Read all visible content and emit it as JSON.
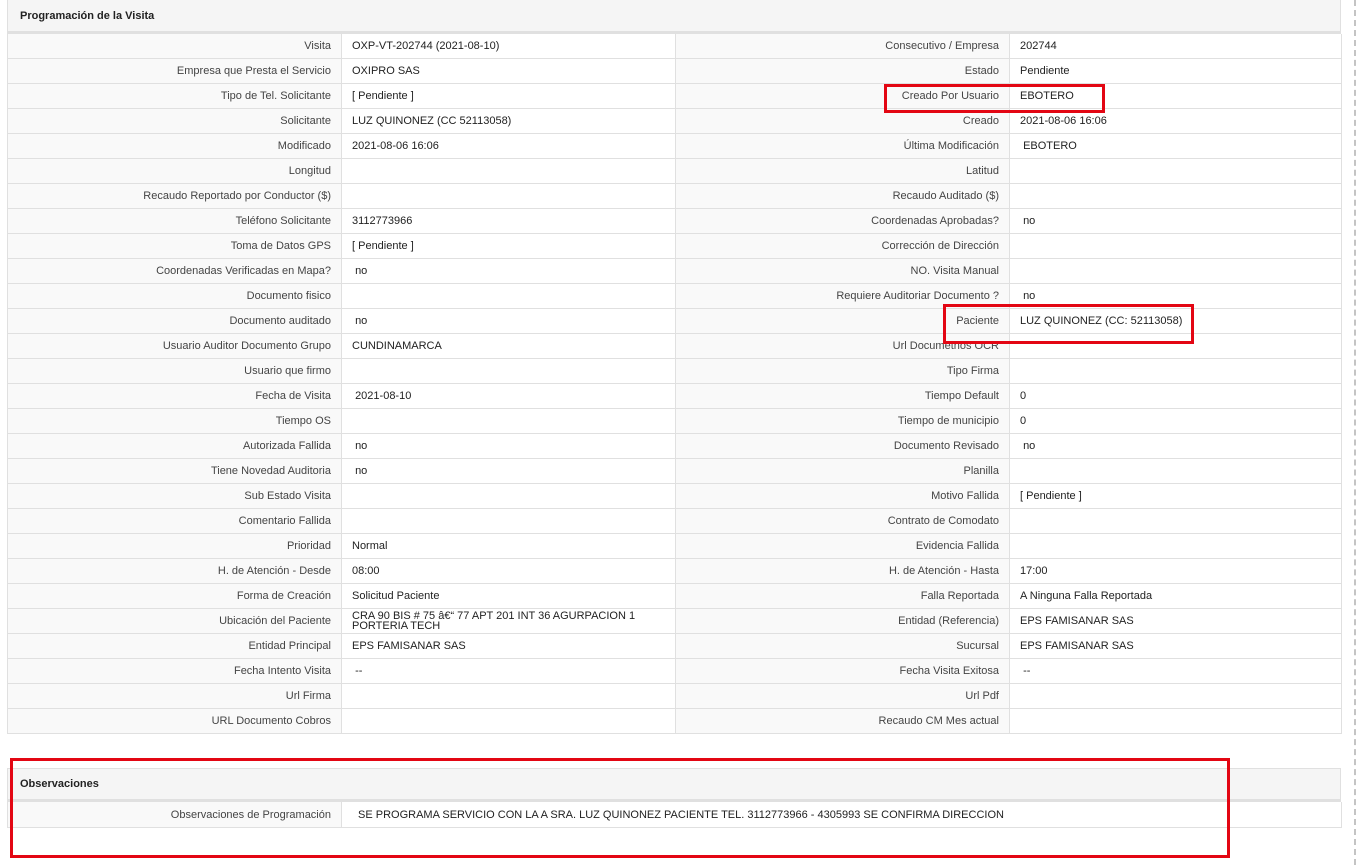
{
  "colors": {
    "highlight": "#e30613",
    "header_bg": "#f5f5f5",
    "border": "#e0e0e0"
  },
  "programacion": {
    "title": "Programación de la Visita",
    "rows": [
      [
        {
          "label": "Visita",
          "value": "OXP-VT-202744 (2021-08-10)"
        },
        {
          "label": "Consecutivo / Empresa",
          "value": "202744"
        }
      ],
      [
        {
          "label": "Empresa que Presta el Servicio",
          "value": "OXIPRO SAS"
        },
        {
          "label": "Estado",
          "value": "Pendiente"
        }
      ],
      [
        {
          "label": "Tipo de Tel. Solicitante",
          "value": "[ Pendiente ]"
        },
        {
          "label": "Creado Por Usuario",
          "value": "EBOTERO"
        }
      ],
      [
        {
          "label": "Solicitante",
          "value": "LUZ QUINONEZ (CC 52113058)"
        },
        {
          "label": "Creado",
          "value": "2021-08-06 16:06"
        }
      ],
      [
        {
          "label": "Modificado",
          "value": "2021-08-06 16:06"
        },
        {
          "label": "Última Modificación",
          "value": " EBOTERO"
        }
      ],
      [
        {
          "label": "Longitud",
          "value": ""
        },
        {
          "label": "Latitud",
          "value": ""
        }
      ],
      [
        {
          "label": "Recaudo Reportado por Conductor ($)",
          "value": ""
        },
        {
          "label": "Recaudo Auditado ($)",
          "value": ""
        }
      ],
      [
        {
          "label": "Teléfono Solicitante",
          "value": "3112773966"
        },
        {
          "label": "Coordenadas Aprobadas?",
          "value": " no"
        }
      ],
      [
        {
          "label": "Toma de Datos GPS",
          "value": "[ Pendiente ]"
        },
        {
          "label": "Corrección de Dirección",
          "value": ""
        }
      ],
      [
        {
          "label": "Coordenadas Verificadas en Mapa?",
          "value": " no"
        },
        {
          "label": "NO. Visita Manual",
          "value": ""
        }
      ],
      [
        {
          "label": "Documento fisico",
          "value": ""
        },
        {
          "label": "Requiere Auditoriar Documento ?",
          "value": " no"
        }
      ],
      [
        {
          "label": "Documento auditado",
          "value": " no"
        },
        {
          "label": "Paciente",
          "value": "LUZ QUINONEZ (CC: 52113058)"
        }
      ],
      [
        {
          "label": "Usuario Auditor Documento Grupo",
          "value": "CUNDINAMARCA"
        },
        {
          "label": "Url Documetnos OCR",
          "value": ""
        }
      ],
      [
        {
          "label": "Usuario que firmo",
          "value": ""
        },
        {
          "label": "Tipo Firma",
          "value": ""
        }
      ],
      [
        {
          "label": "Fecha de Visita",
          "value": " 2021-08-10"
        },
        {
          "label": "Tiempo Default",
          "value": "0"
        }
      ],
      [
        {
          "label": "Tiempo OS",
          "value": ""
        },
        {
          "label": "Tiempo de municipio",
          "value": "0"
        }
      ],
      [
        {
          "label": "Autorizada Fallida",
          "value": " no"
        },
        {
          "label": "Documento Revisado",
          "value": " no"
        }
      ],
      [
        {
          "label": "Tiene Novedad Auditoria",
          "value": " no"
        },
        {
          "label": "Planilla",
          "value": ""
        }
      ],
      [
        {
          "label": "Sub Estado Visita",
          "value": ""
        },
        {
          "label": "Motivo Fallida",
          "value": "[ Pendiente ]"
        }
      ],
      [
        {
          "label": "Comentario Fallida",
          "value": ""
        },
        {
          "label": "Contrato de Comodato",
          "value": ""
        }
      ],
      [
        {
          "label": "Prioridad",
          "value": "Normal"
        },
        {
          "label": "Evidencia Fallida",
          "value": ""
        }
      ],
      [
        {
          "label": "H. de Atención - Desde",
          "value": "08:00"
        },
        {
          "label": "H. de Atención - Hasta",
          "value": "17:00"
        }
      ],
      [
        {
          "label": "Forma de Creación",
          "value": "Solicitud Paciente"
        },
        {
          "label": "Falla Reportada",
          "value": "A Ninguna Falla Reportada"
        }
      ],
      [
        {
          "label": "Ubicación del Paciente",
          "value": "CRA 90 BIS # 75 â€“ 77 APT 201 INT 36 AGURPACION 1\nPORTERIA TECH"
        },
        {
          "label": "Entidad (Referencia)",
          "value": "EPS FAMISANAR SAS"
        }
      ],
      [
        {
          "label": "Entidad Principal",
          "value": "EPS FAMISANAR SAS"
        },
        {
          "label": "Sucursal",
          "value": "EPS FAMISANAR SAS"
        }
      ],
      [
        {
          "label": "Fecha Intento Visita",
          "value": " --"
        },
        {
          "label": "Fecha Visita Exitosa",
          "value": " --"
        }
      ],
      [
        {
          "label": "Url Firma",
          "value": ""
        },
        {
          "label": "Url Pdf",
          "value": ""
        }
      ],
      [
        {
          "label": "URL Documento Cobros",
          "value": ""
        },
        {
          "label": "Recaudo CM Mes actual",
          "value": ""
        }
      ]
    ]
  },
  "observaciones": {
    "title": "Observaciones",
    "label": "Observaciones de Programación",
    "value": "SE PROGRAMA SERVICIO CON LA A SRA. LUZ QUINONEZ PACIENTE TEL. 3112773966 - 4305993 SE CONFIRMA DIRECCION"
  }
}
